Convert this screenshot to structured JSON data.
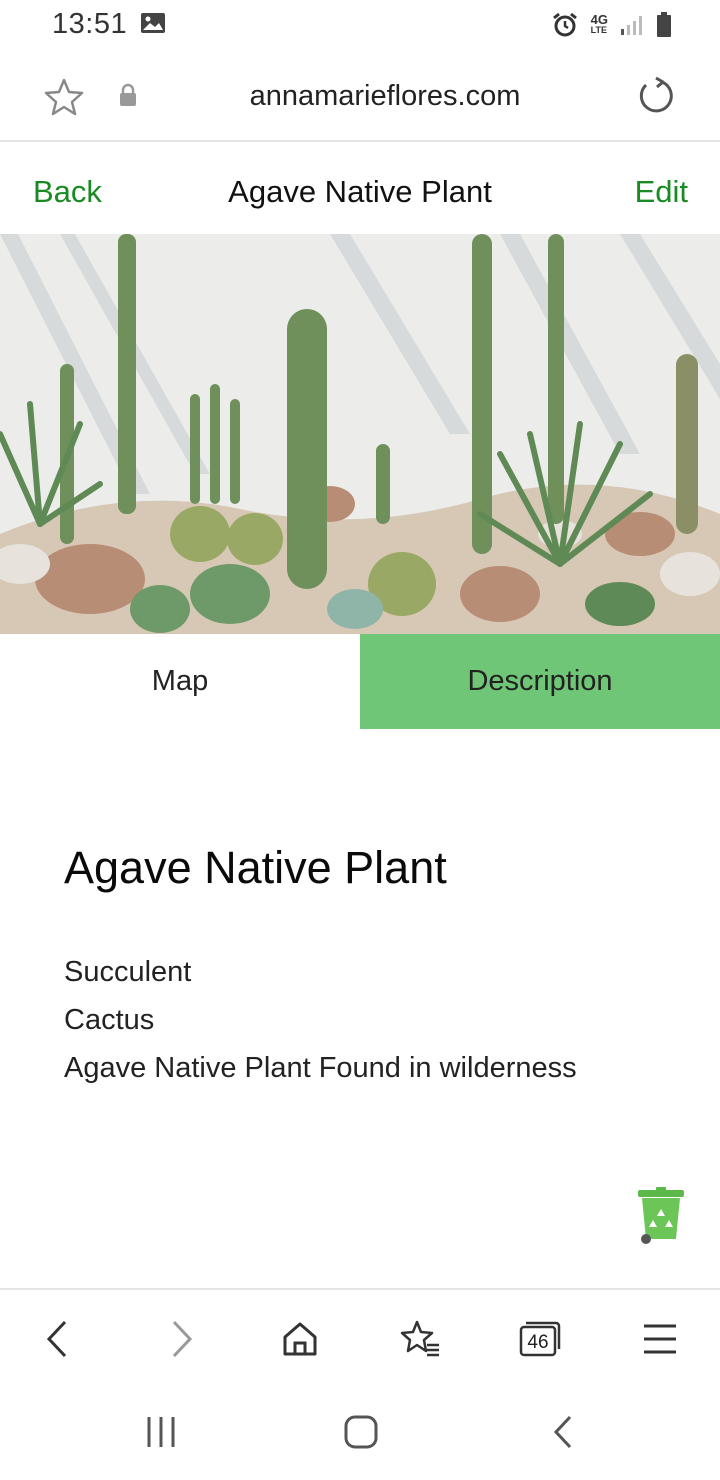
{
  "status_bar": {
    "time": "13:51",
    "network": "4G",
    "network_sub": "LTE",
    "icons": [
      "image-icon",
      "alarm-icon",
      "signal-icon",
      "battery-icon"
    ]
  },
  "browser": {
    "url": "annamarieflores.com",
    "icons": [
      "bookmark-star-icon",
      "lock-icon",
      "reload-icon"
    ]
  },
  "header": {
    "back_label": "Back",
    "title": "Agave Native Plant",
    "edit_label": "Edit",
    "accent_color": "#1a8a23"
  },
  "tabs": [
    {
      "label": "Map",
      "active": false
    },
    {
      "label": "Description",
      "active": true
    }
  ],
  "tab_active_color": "#6fc677",
  "content": {
    "title": "Agave Native Plant",
    "lines": [
      "Succulent",
      "Cactus",
      "Agave Native Plant Found in wilderness"
    ]
  },
  "floating": {
    "icon": "recycle-bin-icon"
  },
  "bottom_nav": {
    "tabs_count": "46",
    "icons": [
      "back-arrow-icon",
      "forward-arrow-icon",
      "home-icon",
      "bookmarks-icon",
      "tabs-icon",
      "menu-icon"
    ]
  },
  "system_nav": {
    "icons": [
      "recent-apps-icon",
      "home-circle-icon",
      "system-back-icon"
    ]
  }
}
